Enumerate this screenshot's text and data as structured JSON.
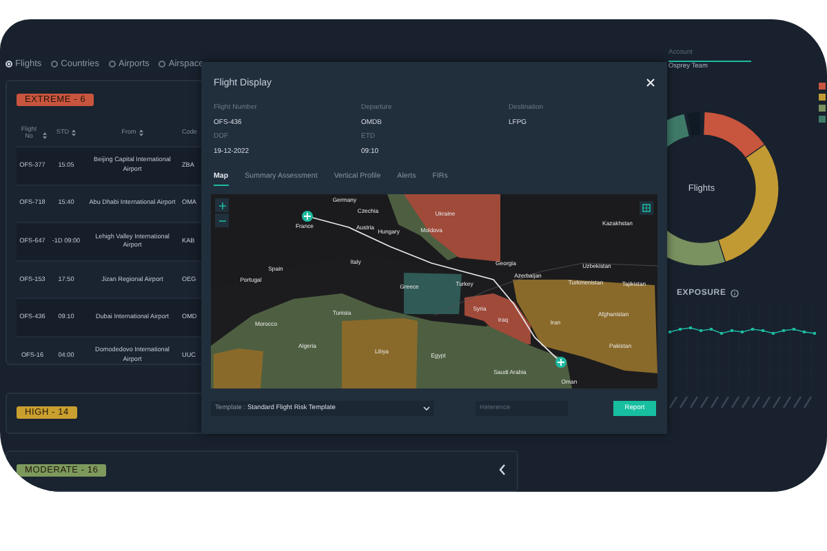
{
  "filters": [
    {
      "label": "Flights",
      "selected": true
    },
    {
      "label": "Countries",
      "selected": false
    },
    {
      "label": "Airports",
      "selected": false
    },
    {
      "label": "Airspace",
      "selected": false
    }
  ],
  "risk_groups": [
    {
      "label": "EXTREME - 6",
      "kind": "extreme",
      "table": {
        "columns": [
          "Flight No",
          "STD",
          "From",
          "Code"
        ],
        "rows": [
          [
            "OFS-377",
            "15:05",
            "Beijing Capital International Airport",
            "ZBA"
          ],
          [
            "OFS-718",
            "15:40",
            "Abu Dhabi International Airport",
            "OMA"
          ],
          [
            "OFS-647",
            "-1D 09:00",
            "Lehigh Valley International Airport",
            "KAB"
          ],
          [
            "OFS-153",
            "17:50",
            "Jizan Regional Airport",
            "OEG"
          ],
          [
            "OFS-436",
            "09:10",
            "Dubai International Airport",
            "OMD"
          ],
          [
            "OFS-16",
            "04:00",
            "Domodedovo International Airport",
            "UUC"
          ]
        ]
      }
    },
    {
      "label": "HIGH - 14",
      "kind": "high"
    },
    {
      "label": "MODERATE - 16",
      "kind": "moderate"
    }
  ],
  "account": {
    "label": "Account",
    "value": "Osprey Team"
  },
  "donut": {
    "center_label": "Flights"
  },
  "exposure": {
    "title": "EXPOSURE"
  },
  "modal": {
    "title": "Flight Display",
    "fields": [
      {
        "label": "Flight Number",
        "value": "OFS-436"
      },
      {
        "label": "Departure",
        "value": "OMDB"
      },
      {
        "label": "Destination",
        "value": "LFPG"
      },
      {
        "label": "DOF",
        "value": "19-12-2022"
      },
      {
        "label": "ETD",
        "value": "09:10"
      }
    ],
    "tabs": [
      {
        "label": "Map",
        "selected": true
      },
      {
        "label": "Summary Assessment",
        "selected": false
      },
      {
        "label": "Vertical Profile",
        "selected": false
      },
      {
        "label": "Alerts",
        "selected": false
      },
      {
        "label": "FIRs",
        "selected": false
      }
    ],
    "map": {
      "labels": [
        "Germany",
        "Czechia",
        "Ukraine",
        "Kazakhstan",
        "France",
        "Austria",
        "Hungary",
        "Moldova",
        "Italy",
        "Spain",
        "Portugal",
        "Georgia",
        "Azerbaijan",
        "Uzbekistan",
        "Greece",
        "Turkey",
        "Turkmenistan",
        "Tajikistan",
        "Syria",
        "Iraq",
        "Iran",
        "Afghanistan",
        "Tunisia",
        "Morocco",
        "Algeria",
        "Libya",
        "Egypt",
        "Pakistan",
        "Saudi Arabia",
        "Oman"
      ]
    },
    "template": {
      "label": "Template :",
      "value": "Standard Flight Risk Template"
    },
    "reference": {
      "placeholder": "Reference"
    },
    "report_button": "Report"
  }
}
